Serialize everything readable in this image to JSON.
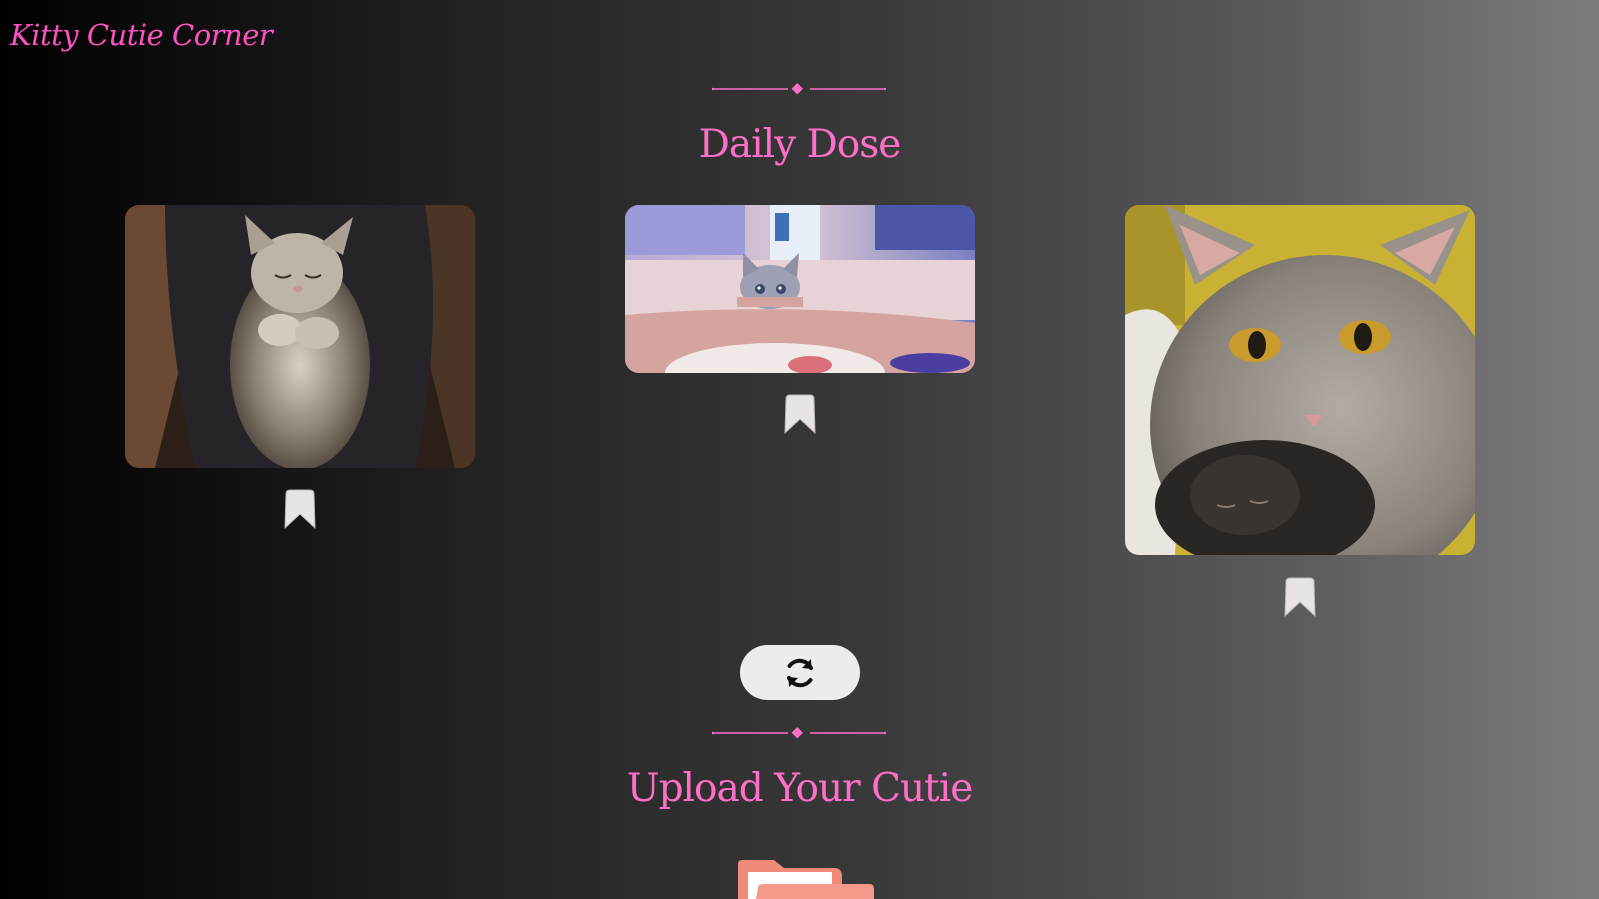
{
  "header": {
    "brand": "Kitty Cutie Corner"
  },
  "daily_dose": {
    "title": "Daily Dose",
    "cards": [
      {
        "image": "sleeping-kitten-on-lap",
        "bookmark_icon": "bookmark-icon"
      },
      {
        "image": "kitten-peeking-over-table",
        "bookmark_icon": "bookmark-icon"
      },
      {
        "image": "gray-cat-hugging-kitten",
        "bookmark_icon": "bookmark-icon"
      }
    ],
    "refresh_icon": "refresh-icon"
  },
  "upload": {
    "title": "Upload Your Cutie",
    "icon": "folder-icon"
  },
  "colors": {
    "accent_pink": "#ff6fc7",
    "button_bg": "#ececec",
    "folder": "#f08a7a"
  }
}
